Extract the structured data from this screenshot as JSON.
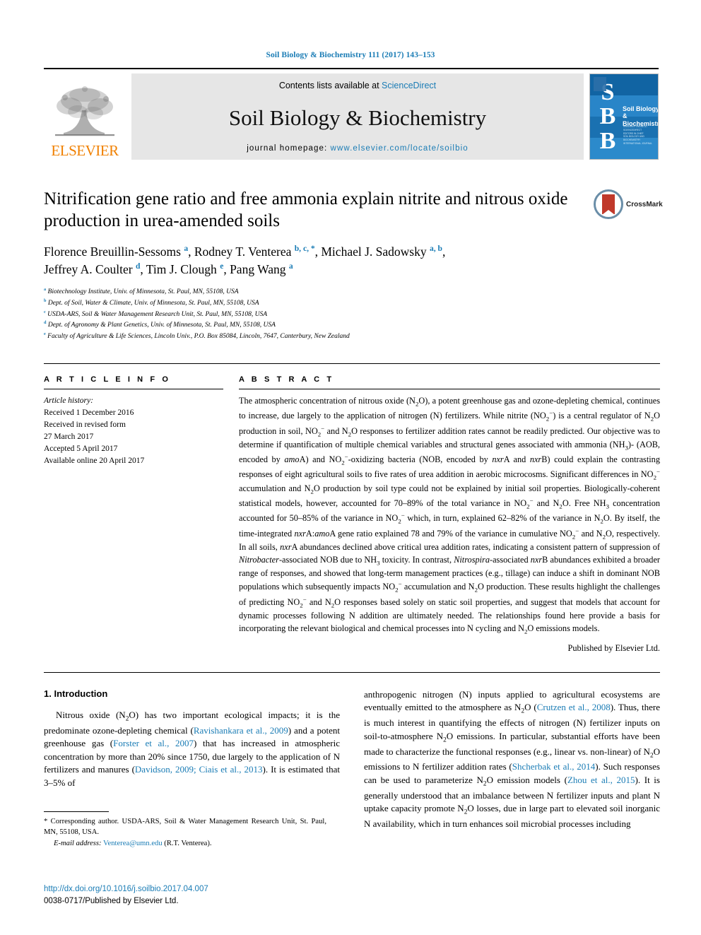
{
  "running_head": "Soil Biology & Biochemistry 111 (2017) 143–153",
  "masthead": {
    "publisher": "ELSEVIER",
    "contents_prefix": "Contents lists available at ",
    "contents_link": "ScienceDirect",
    "journal_title": "Soil Biology & Biochemistry",
    "homepage_prefix": "journal homepage: ",
    "homepage_url": "www.elsevier.com/locate/soilbio",
    "cover": {
      "letters": [
        "S",
        "B",
        "B"
      ],
      "journal_name_line1": "Soil Biology &",
      "journal_name_line2": "Biochemistry",
      "accent_color": "#1f7fc4"
    }
  },
  "article": {
    "title": "Nitrification gene ratio and free ammonia explain nitrite and nitrous oxide production in urea-amended soils",
    "crossmark_label": "CrossMark",
    "authors_line1_html": "Florence Breuillin-Sessoms <sup>a</sup>, Rodney T. Venterea <sup>b, c, *</sup>, Michael J. Sadowsky <sup>a, b</sup>,",
    "authors_line2_html": "Jeffrey A. Coulter <sup>d</sup>, Tim J. Clough <sup>e</sup>, Pang Wang <sup>a</sup>",
    "affiliations": [
      {
        "marker": "a",
        "text": "Biotechnology Institute, Univ. of Minnesota, St. Paul, MN, 55108, USA"
      },
      {
        "marker": "b",
        "text": "Dept. of Soil, Water & Climate, Univ. of Minnesota, St. Paul, MN, 55108, USA"
      },
      {
        "marker": "c",
        "text": "USDA-ARS, Soil & Water Management Research Unit, St. Paul, MN, 55108, USA"
      },
      {
        "marker": "d",
        "text": "Dept. of Agronomy & Plant Genetics, Univ. of Minnesota, St. Paul, MN, 55108, USA"
      },
      {
        "marker": "e",
        "text": "Faculty of Agriculture & Life Sciences, Lincoln Univ., P.O. Box 85084, Lincoln, 7647, Canterbury, New Zealand"
      }
    ]
  },
  "article_info": {
    "heading": "A R T I C L E  I N F O",
    "history_label": "Article history:",
    "history": [
      "Received 1 December 2016",
      "Received in revised form",
      "27 March 2017",
      "Accepted 5 April 2017",
      "Available online 20 April 2017"
    ]
  },
  "abstract": {
    "heading": "A B S T R A C T",
    "body_html": "The atmospheric concentration of nitrous oxide (N<sub>2</sub>O), a potent greenhouse gas and ozone-depleting chemical, continues to increase, due largely to the application of nitrogen (N) fertilizers. While nitrite (NO<sub>2</sub><sup class=\"inline-sup\">−</sup>) is a central regulator of N<sub>2</sub>O production in soil, NO<sub>2</sub><sup class=\"inline-sup\">−</sup> and N<sub>2</sub>O responses to fertilizer addition rates cannot be readily predicted. Our objective was to determine if quantification of multiple chemical variables and structural genes associated with ammonia (NH<sub>3</sub>)- (AOB, encoded by <i>amo</i>A) and NO<sub>2</sub><sup class=\"inline-sup\">−</sup>-oxidizing bacteria (NOB, encoded by <i>nxr</i>A and <i>nxr</i>B) could explain the contrasting responses of eight agricultural soils to five rates of urea addition in aerobic microcosms. Significant differences in NO<sub>2</sub><sup class=\"inline-sup\">−</sup> accumulation and N<sub>2</sub>O production by soil type could not be explained by initial soil properties. Biologically-coherent statistical models, however, accounted for 70–89% of the total variance in NO<sub>2</sub><sup class=\"inline-sup\">−</sup> and N<sub>2</sub>O. Free NH<sub>3</sub> concentration accounted for 50–85% of the variance in NO<sub>2</sub><sup class=\"inline-sup\">−</sup> which, in turn, explained 62–82% of the variance in N<sub>2</sub>O. By itself, the time-integrated <i>nxr</i>A:<i>amo</i>A gene ratio explained 78 and 79% of the variance in cumulative NO<sub>2</sub><sup class=\"inline-sup\">−</sup> and N<sub>2</sub>O, respectively. In all soils, <i>nxr</i>A abundances declined above critical urea addition rates, indicating a consistent pattern of suppression of <i>Nitrobacter</i>-associated NOB due to NH<sub>3</sub> toxicity. In contrast, <i>Nitrospira</i>-associated <i>nxr</i>B abundances exhibited a broader range of responses, and showed that long-term management practices (e.g., tillage) can induce a shift in dominant NOB populations which subsequently impacts NO<sub>2</sub><sup class=\"inline-sup\">−</sup> accumulation and N<sub>2</sub>O production. These results highlight the challenges of predicting NO<sub>2</sub><sup class=\"inline-sup\">−</sup> and N<sub>2</sub>O responses based solely on static soil properties, and suggest that models that account for dynamic processes following N addition are ultimately needed. The relationships found here provide a basis for incorporating the relevant biological and chemical processes into N cycling and N<sub>2</sub>O emissions models.",
    "published_by": "Published by Elsevier Ltd."
  },
  "introduction": {
    "heading": "1.  Introduction",
    "left_html": "Nitrous oxide (N<sub>2</sub>O) has two important ecological impacts; it is the predominate ozone-depleting chemical (<span class=\"ref\">Ravishankara et al., 2009</span>) and a potent greenhouse gas (<span class=\"ref\">Forster et al., 2007</span>) that has increased in atmospheric concentration by more than 20% since 1750, due largely to the application of N fertilizers and manures (<span class=\"ref\">Davidson, 2009; Ciais et al., 2013</span>). It is estimated that 3–5% of",
    "right_html": "anthropogenic nitrogen (N) inputs applied to agricultural ecosystems are eventually emitted to the atmosphere as N<sub>2</sub>O (<span class=\"ref\">Crutzen et al., 2008</span>). Thus, there is much interest in quantifying the effects of nitrogen (N) fertilizer inputs on soil-to-atmosphere N<sub>2</sub>O emissions. In particular, substantial efforts have been made to characterize the functional responses (e.g., linear vs. non-linear) of N<sub>2</sub>O emissions to N fertilizer addition rates (<span class=\"ref\">Shcherbak et al., 2014</span>). Such responses can be used to parameterize N<sub>2</sub>O emission models (<span class=\"ref\">Zhou et al., 2015</span>). It is generally understood that an imbalance between N fertilizer inputs and plant N uptake capacity promote N<sub>2</sub>O losses, due in large part to elevated soil inorganic N availability, which in turn enhances soil microbial processes including"
  },
  "footnote": {
    "corresponding_html": "* Corresponding author. USDA-ARS, Soil & Water Management Research Unit, St. Paul, MN, 55108, USA.",
    "email_label": "E-mail address:",
    "email": "Venterea@umn.edu",
    "email_owner": "(R.T. Venterea)."
  },
  "colophon": {
    "doi": "http://dx.doi.org/10.1016/j.soilbio.2017.04.007",
    "issn": "0038-0717/Published by Elsevier Ltd."
  }
}
